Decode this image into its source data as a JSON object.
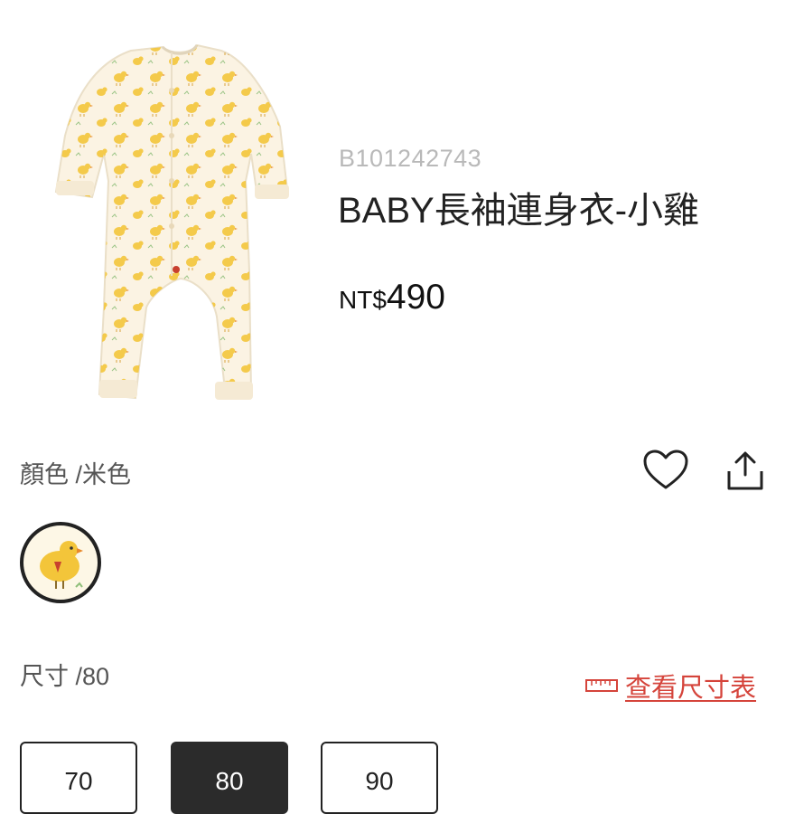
{
  "product": {
    "sku": "B101242743",
    "title": "BABY長袖連身衣-小雞",
    "price_currency": "NT$",
    "price_amount": "490",
    "image_icon": "romper-image"
  },
  "actions": {
    "favorite_icon": "heart-icon",
    "share_icon": "share-icon"
  },
  "color": {
    "label": "顏色 /米色",
    "swatch_icon": "chick-swatch"
  },
  "size": {
    "label": "尺寸 /80",
    "chart_link": "查看尺寸表",
    "chart_icon": "ruler-icon",
    "options": [
      "70",
      "80",
      "90"
    ],
    "selected": "80"
  },
  "colors": {
    "accent_red": "#d5443b",
    "selected_bg": "#2b2b2b",
    "muted_gray": "#b9b9b9"
  }
}
